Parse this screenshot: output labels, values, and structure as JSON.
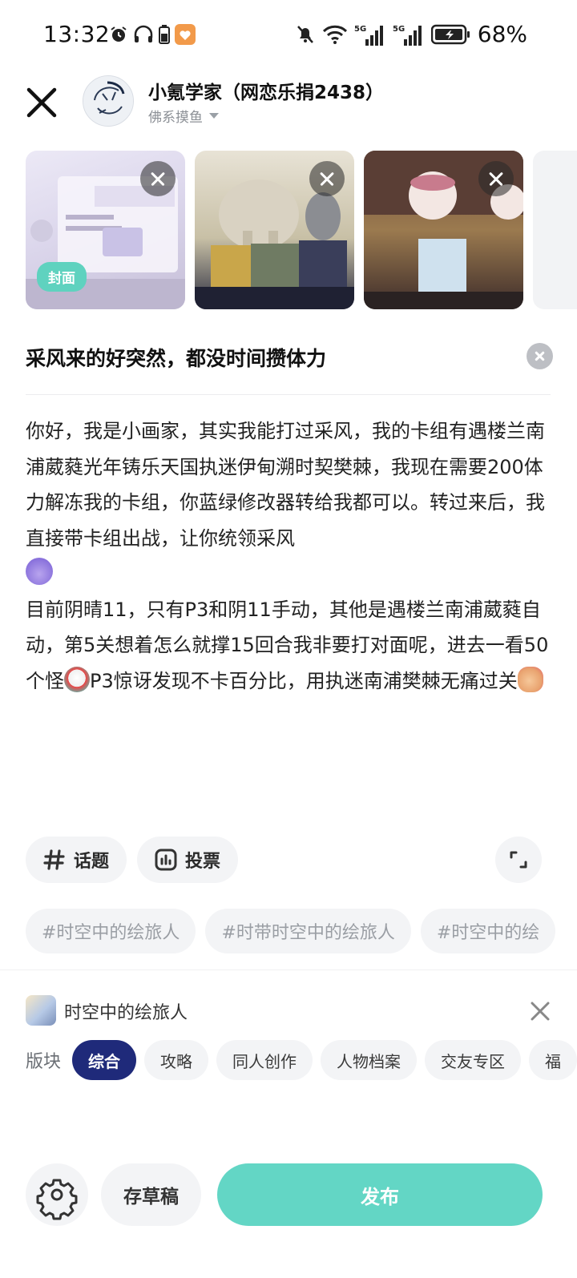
{
  "status_bar": {
    "time": "13:32",
    "battery_pct": "68%",
    "icons": [
      "alarm-icon",
      "headphones-icon",
      "phone-battery-icon",
      "heart-app-icon",
      "mute-bell-icon",
      "wifi-icon",
      "signal-5g-icon",
      "signal-5g-icon",
      "battery-charging-icon"
    ]
  },
  "header": {
    "user_name": "小氪学家（网恋乐捐2438）",
    "user_status": "佛系摸鱼"
  },
  "images": {
    "cover_label": "封面",
    "count": 3
  },
  "post": {
    "title": "采风来的好突然，都没时间攒体力",
    "body_p1": "你好，我是小画家，其实我能打过采风，我的卡组有遇楼兰南浦葳蕤光年铸乐天国执迷伊甸溯时契樊棘，我现在需要200体力解冻我的卡组，你蓝绿修改器转给我都可以。转过来后，我直接带卡组出战，让你统领采风",
    "body_p2a": "目前阴晴11，只有P3和阴11手动，其他是遇楼兰南浦葳蕤自动，第5关想着怎么就撑15回合我非要打对面呢，进去一看50个怪",
    "body_p2b": "P3惊讶发现不卡百分比，用执迷南浦樊棘无痛过关"
  },
  "tools": {
    "topic_label": "话题",
    "vote_label": "投票"
  },
  "tags": [
    "#时空中的绘旅人",
    "#时带时空中的绘旅人",
    "#时空中的绘"
  ],
  "game": {
    "name": "时空中的绘旅人",
    "board_label": "版块",
    "boards": [
      "综合",
      "攻略",
      "同人创作",
      "人物档案",
      "交友专区",
      "福"
    ],
    "active_board": "综合"
  },
  "bottom": {
    "draft_label": "存草稿",
    "publish_label": "发布"
  },
  "colors": {
    "accent": "#63d6c5",
    "active_board": "#1f2a7a",
    "cover_badge": "#5fd2bf"
  }
}
